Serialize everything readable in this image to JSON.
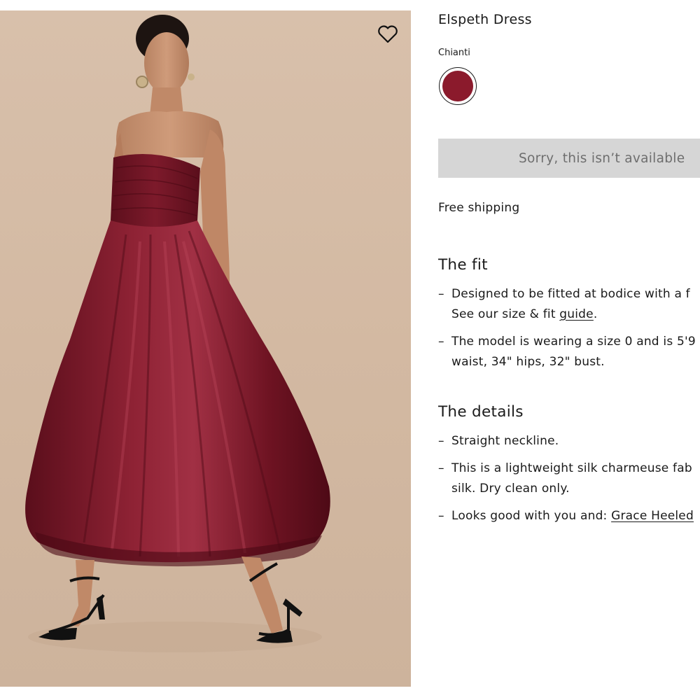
{
  "product": {
    "title": "Elspeth Dress",
    "color_name": "Chianti",
    "swatch_color": "#8b1a2c",
    "cta_label": "Sorry, this isn’t available",
    "shipping_text": "Free shipping"
  },
  "fit": {
    "heading": "The fit",
    "bullet1_line1": "Designed to be fitted at bodice with a f",
    "bullet1_line2_prefix": "See our size & fit ",
    "bullet1_link": "guide",
    "bullet1_line2_suffix": ".",
    "bullet2_line1": "The model is wearing a size 0 and is 5'9",
    "bullet2_line2": "waist, 34\" hips, 32\" bust."
  },
  "details": {
    "heading": "The details",
    "bullet1": "Straight neckline.",
    "bullet2_line1": "This is a lightweight silk charmeuse fab",
    "bullet2_line2": "silk. Dry clean only.",
    "bullet3_prefix": "Looks good with you and: ",
    "bullet3_link": "Grace Heeled"
  },
  "bullet_dash": "–",
  "colors": {
    "background_photo": "#d6bda7",
    "dress": "#7a1526",
    "button_bg": "#d6d6d6",
    "button_text": "#6e6e6e"
  },
  "icons": {
    "wishlist": "heart-icon"
  }
}
